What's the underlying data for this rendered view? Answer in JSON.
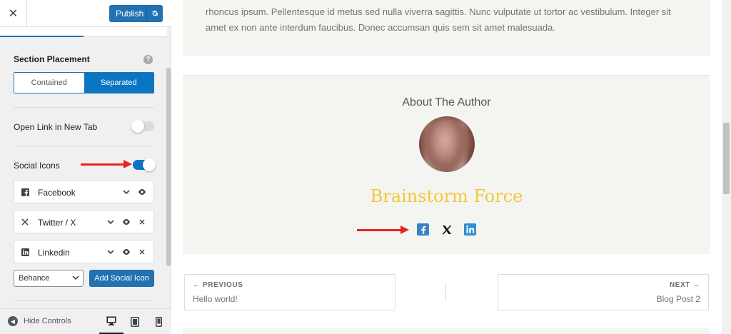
{
  "sidebar": {
    "close_icon": "close-icon",
    "publish_label": "Publish",
    "publish_settings_icon": "gear-icon",
    "section_placement": {
      "label": "Section Placement",
      "help": "?",
      "options": [
        "Contained",
        "Separated"
      ],
      "selected": "Separated"
    },
    "open_link_new_tab": {
      "label": "Open Link in New Tab",
      "enabled": false
    },
    "social_icons": {
      "label": "Social Icons",
      "enabled": true
    },
    "social_items": [
      {
        "icon": "facebook-icon",
        "name": "Facebook",
        "removable": false
      },
      {
        "icon": "twitter-x-icon",
        "name": "Twitter / X",
        "removable": true
      },
      {
        "icon": "linkedin-icon",
        "name": "Linkedin",
        "removable": true
      }
    ],
    "add_select_value": "Behance",
    "add_button_label": "Add Social Icon",
    "hide_controls_label": "Hide Controls",
    "devices": [
      "desktop",
      "tablet",
      "mobile"
    ],
    "active_device": "desktop"
  },
  "preview": {
    "post_text": "rhoncus ipsum. Pellentesque id metus sed nulla viverra sagittis. Nunc vulputate ut tortor ac vestibulum. Integer sit amet ex non ante interdum faucibus. Donec accumsan quis sem sit amet malesuada.",
    "author_heading": "About The Author",
    "author_name": "Brainstorm Force",
    "author_social": [
      "facebook-icon",
      "x-icon",
      "linkedin-icon"
    ],
    "previous": {
      "label": "← PREVIOUS",
      "title": "Hello world!"
    },
    "next": {
      "label": "NEXT →",
      "title": "Blog Post 2"
    }
  },
  "colors": {
    "accent": "#2271b1",
    "toggle_on": "#0a75c2",
    "author_name": "#f3c73a",
    "annotation_arrow": "#e52320"
  }
}
